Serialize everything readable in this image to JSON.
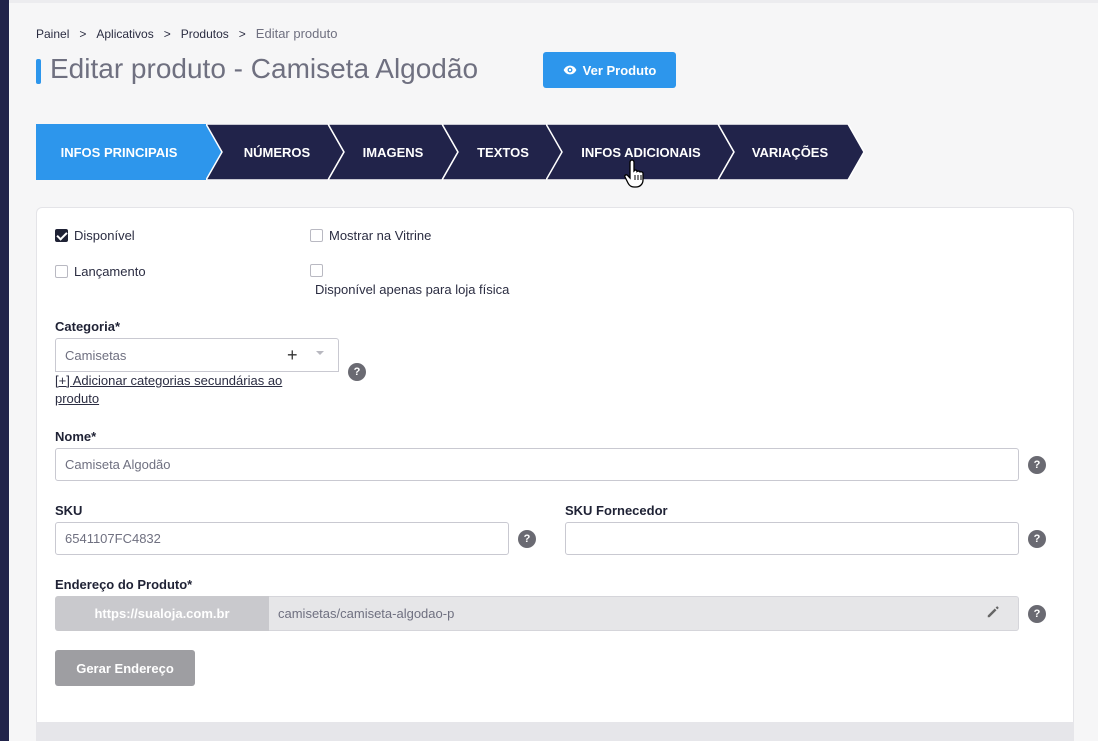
{
  "breadcrumb": {
    "items": [
      "Painel",
      "Aplicativos",
      "Produtos"
    ],
    "current": "Editar produto",
    "separator": ">"
  },
  "header": {
    "title": "Editar produto - Camiseta Algodão",
    "view_button": "Ver Produto",
    "view_icon": "eye-icon"
  },
  "tabs": [
    {
      "label": "INFOS PRINCIPAIS",
      "active": true
    },
    {
      "label": "NÚMEROS",
      "active": false
    },
    {
      "label": "IMAGENS",
      "active": false
    },
    {
      "label": "TEXTOS",
      "active": false
    },
    {
      "label": "INFOS ADICIONAIS",
      "active": false
    },
    {
      "label": "VARIAÇÕES",
      "active": false
    }
  ],
  "form": {
    "disponivel": {
      "label": "Disponível",
      "checked": true
    },
    "vitrine": {
      "label": "Mostrar na Vitrine",
      "checked": false
    },
    "lancamento": {
      "label": "Lançamento",
      "checked": false
    },
    "loja_fisica": {
      "label": "Disponível apenas para loja física",
      "checked": false
    },
    "categoria": {
      "label": "Categoria*",
      "value": "Camisetas",
      "add_secondary": "[+] Adicionar categorias secundárias ao produto"
    },
    "nome": {
      "label": "Nome*",
      "value": "Camiseta Algodão"
    },
    "sku": {
      "label": "SKU",
      "value": "6541107FC4832"
    },
    "sku_fornecedor": {
      "label": "SKU Fornecedor",
      "value": ""
    },
    "endereco": {
      "label": "Endereço do Produto*",
      "prefix": "https://sualoja.com.br",
      "value": "camisetas/camiseta-algodao-p"
    },
    "gerar_button": "Gerar Endereço",
    "help_glyph": "?",
    "plus_glyph": "+"
  },
  "colors": {
    "accent": "#2d96ec",
    "nav_dark": "#21234a",
    "help": "#6a6a72",
    "disabled_button": "#9e9ea2"
  }
}
